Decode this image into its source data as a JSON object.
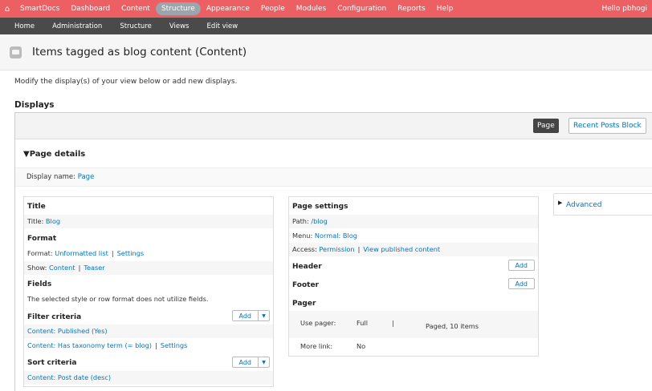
{
  "toolbar": {
    "home_icon": "home-icon",
    "items": [
      {
        "label": "SmartDocs",
        "active": false
      },
      {
        "label": "Dashboard",
        "active": false
      },
      {
        "label": "Content",
        "active": false
      },
      {
        "label": "Structure",
        "active": true
      },
      {
        "label": "Appearance",
        "active": false
      },
      {
        "label": "People",
        "active": false
      },
      {
        "label": "Modules",
        "active": false
      },
      {
        "label": "Configuration",
        "active": false
      },
      {
        "label": "Reports",
        "active": false
      },
      {
        "label": "Help",
        "active": false
      }
    ],
    "hello": "Hello pbhogi",
    "color": "#ec5f63"
  },
  "subbar": {
    "items": [
      "Home",
      "Administration",
      "Structure",
      "Views",
      "Edit view"
    ]
  },
  "page": {
    "title": "Items tagged as blog content (Content)",
    "intro": "Modify the display(s) of your view below or add new displays.",
    "displays_heading": "Displays"
  },
  "tabs": {
    "page": "Page",
    "recent": "Recent Posts Block"
  },
  "details": {
    "title": "Page details",
    "display_name_label": "Display name:",
    "display_name_value": "Page"
  },
  "left": {
    "title_heading": "Title",
    "title_label": "Title:",
    "title_value": "Blog",
    "format_heading": "Format",
    "format_label": "Format:",
    "format_value": "Unformatted list",
    "format_settings": "Settings",
    "show_label": "Show:",
    "show_value": "Content",
    "show_teaser": "Teaser",
    "fields_heading": "Fields",
    "fields_note": "The selected style or row format does not utilize fields.",
    "filter_heading": "Filter criteria",
    "filter_add": "Add",
    "filter_1": "Content: Published (Yes)",
    "filter_2": "Content: Has taxonomy term (= blog)",
    "filter_2_settings": "Settings",
    "sort_heading": "Sort criteria",
    "sort_add": "Add",
    "sort_1": "Content: Post date (desc)"
  },
  "right": {
    "page_settings_heading": "Page settings",
    "path_label": "Path:",
    "path_value": "/blog",
    "menu_label": "Menu:",
    "menu_value": "Normal: Blog",
    "access_label": "Access:",
    "access_value": "Permission",
    "access_view": "View published content",
    "header_heading": "Header",
    "header_add": "Add",
    "footer_heading": "Footer",
    "footer_add": "Add",
    "pager_heading": "Pager",
    "use_pager_label": "Use pager:",
    "use_pager_value": "Full",
    "pager_sep": "|",
    "pager_items": "Paged, 10 items",
    "more_link_label": "More link:",
    "more_link_value": "No"
  },
  "advanced": {
    "label": "Advanced"
  }
}
